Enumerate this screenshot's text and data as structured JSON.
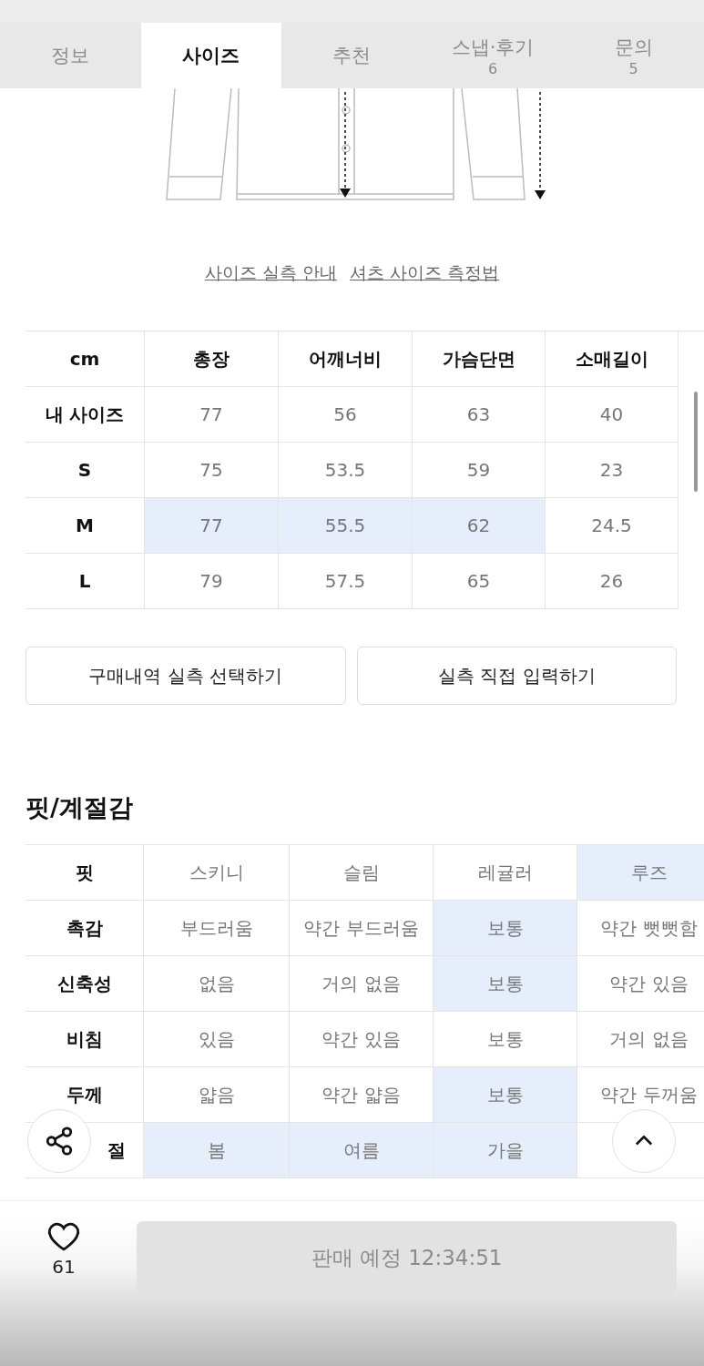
{
  "tabs": [
    {
      "label": "정보",
      "selected": false
    },
    {
      "label": "사이즈",
      "selected": true
    },
    {
      "label": "추천",
      "selected": false
    },
    {
      "label": "스냅·후기",
      "count": "6",
      "selected": false
    },
    {
      "label": "문의",
      "count": "5",
      "selected": false
    }
  ],
  "links": [
    "사이즈 실측 안내",
    "셔츠 사이즈 측정법"
  ],
  "size_table": {
    "corner": "cm",
    "columns": [
      "총장",
      "어깨너비",
      "가슴단면",
      "소매길이"
    ],
    "rows": [
      {
        "label": "내 사이즈",
        "cells": [
          {
            "text": "77",
            "selected": false
          },
          {
            "text": "56",
            "selected": false
          },
          {
            "text": "63",
            "selected": false
          },
          {
            "text": "40",
            "selected": false
          }
        ]
      },
      {
        "label": "S",
        "cells": [
          {
            "text": "75",
            "selected": false
          },
          {
            "text": "53.5",
            "selected": false
          },
          {
            "text": "59",
            "selected": false
          },
          {
            "text": "23",
            "selected": false
          }
        ]
      },
      {
        "label": "M",
        "cells": [
          {
            "text": "77",
            "selected": true
          },
          {
            "text": "55.5",
            "selected": true
          },
          {
            "text": "62",
            "selected": true
          },
          {
            "text": "24.5",
            "selected": false
          }
        ]
      },
      {
        "label": "L",
        "cells": [
          {
            "text": "79",
            "selected": false
          },
          {
            "text": "57.5",
            "selected": false
          },
          {
            "text": "65",
            "selected": false
          },
          {
            "text": "26",
            "selected": false
          }
        ]
      }
    ]
  },
  "size_buttons": [
    "구매내역 실측 선택하기",
    "실측 직접 입력하기"
  ],
  "fit_heading": "핏/계절감",
  "fit_table": [
    {
      "label": "핏",
      "cells": [
        {
          "text": "스키니",
          "selected": false
        },
        {
          "text": "슬림",
          "selected": false
        },
        {
          "text": "레귤러",
          "selected": false
        },
        {
          "text": "루즈",
          "selected": true
        }
      ]
    },
    {
      "label": "촉감",
      "cells": [
        {
          "text": "부드러움",
          "selected": false
        },
        {
          "text": "약간 부드러움",
          "selected": false
        },
        {
          "text": "보통",
          "selected": true
        },
        {
          "text": "약간 뻣뻣함",
          "selected": false
        }
      ]
    },
    {
      "label": "신축성",
      "cells": [
        {
          "text": "없음",
          "selected": false
        },
        {
          "text": "거의 없음",
          "selected": false
        },
        {
          "text": "보통",
          "selected": true
        },
        {
          "text": "약간 있음",
          "selected": false
        }
      ]
    },
    {
      "label": "비침",
      "cells": [
        {
          "text": "있음",
          "selected": false
        },
        {
          "text": "약간 있음",
          "selected": false
        },
        {
          "text": "보통",
          "selected": false
        },
        {
          "text": "거의 없음",
          "selected": false
        }
      ]
    },
    {
      "label": "두께",
      "cells": [
        {
          "text": "얇음",
          "selected": false
        },
        {
          "text": "약간 얇음",
          "selected": false
        },
        {
          "text": "보통",
          "selected": true
        },
        {
          "text": "약간 두꺼움",
          "selected": false
        }
      ]
    },
    {
      "label": "절",
      "cells": [
        {
          "text": "봄",
          "selected": true
        },
        {
          "text": "여름",
          "selected": true
        },
        {
          "text": "가을",
          "selected": true
        }
      ]
    }
  ],
  "likes": "61",
  "buy_button": {
    "label": "판매 예정 12:34:51",
    "disabled": true
  }
}
